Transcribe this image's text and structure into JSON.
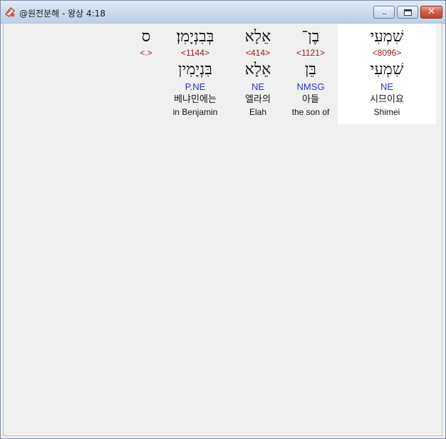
{
  "window": {
    "title": "@원전분해 - 왕상 4:18",
    "icon": "app-icon",
    "close_glyph": "✕"
  },
  "colors": {
    "strong_number": "#a01818",
    "morphology": "#2b33c6",
    "selected_background": "#ffffff"
  },
  "words": [
    {
      "hebrew": "שִׁמְעִי",
      "strong": "<8096>",
      "lemma": "שִׁמְעִי",
      "morph": "NE",
      "korean": "시므이요",
      "english": "Shimei",
      "selected": true
    },
    {
      "hebrew": "בֶן־",
      "strong": "<1121>",
      "lemma": "בֵּן",
      "morph": "NMSG",
      "korean": "아들",
      "english": "the son of"
    },
    {
      "hebrew": "אֵלָא",
      "strong": "<414>",
      "lemma": "אֵלָא",
      "morph": "NE",
      "korean": "엘라의",
      "english": "Elah"
    },
    {
      "hebrew": "בְּבִנְיָמִן׃",
      "strong": "<1144>",
      "lemma": "בִּנְיָמִין",
      "morph": "P.NE",
      "korean": "베냐민에는",
      "english": "in Benjamin"
    },
    {
      "hebrew": "ס",
      "strong": "<.>"
    }
  ]
}
